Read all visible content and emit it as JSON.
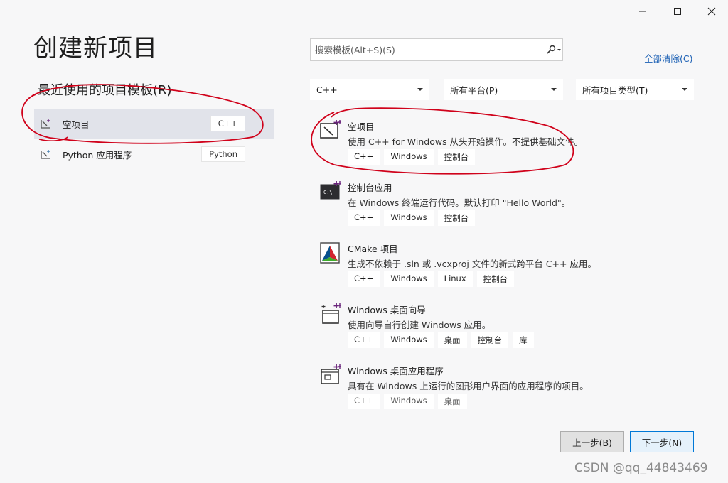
{
  "title": "创建新项目",
  "recent": {
    "heading": "最近使用的项目模板(R)",
    "items": [
      {
        "name": "空项目",
        "lang": "C++"
      },
      {
        "name": "Python 应用程序",
        "lang": "Python"
      }
    ]
  },
  "search": {
    "placeholder": "搜索模板(Alt+S)(S)"
  },
  "clear_all": "全部清除(C)",
  "filters": {
    "language": "C++",
    "platform": "所有平台(P)",
    "project_type": "所有项目类型(T)"
  },
  "templates": [
    {
      "name": "空项目",
      "desc": "使用 C++ for Windows 从头开始操作。不提供基础文件。",
      "tags": [
        "C++",
        "Windows",
        "控制台"
      ],
      "icon": "empty-project-icon"
    },
    {
      "name": "控制台应用",
      "desc": "在 Windows 终端运行代码。默认打印 \"Hello World\"。",
      "tags": [
        "C++",
        "Windows",
        "控制台"
      ],
      "icon": "console-app-icon"
    },
    {
      "name": "CMake 项目",
      "desc": "生成不依赖于 .sln 或 .vcxproj 文件的新式跨平台 C++ 应用。",
      "tags": [
        "C++",
        "Windows",
        "Linux",
        "控制台"
      ],
      "icon": "cmake-icon"
    },
    {
      "name": "Windows 桌面向导",
      "desc": "使用向导自行创建 Windows 应用。",
      "tags": [
        "C++",
        "Windows",
        "桌面",
        "控制台",
        "库"
      ],
      "icon": "wizard-icon"
    },
    {
      "name": "Windows 桌面应用程序",
      "desc": "具有在 Windows 上运行的图形用户界面的应用程序的项目。",
      "tags": [
        "C++",
        "Windows",
        "桌面"
      ],
      "icon": "desktop-app-icon"
    }
  ],
  "buttons": {
    "back": "上一步(B)",
    "next": "下一步(N)"
  },
  "watermark": "CSDN @qq_44843469",
  "colors": {
    "accent": "#0078d7",
    "annotation": "#d0021b",
    "selected_bg": "#e1e3ea"
  }
}
